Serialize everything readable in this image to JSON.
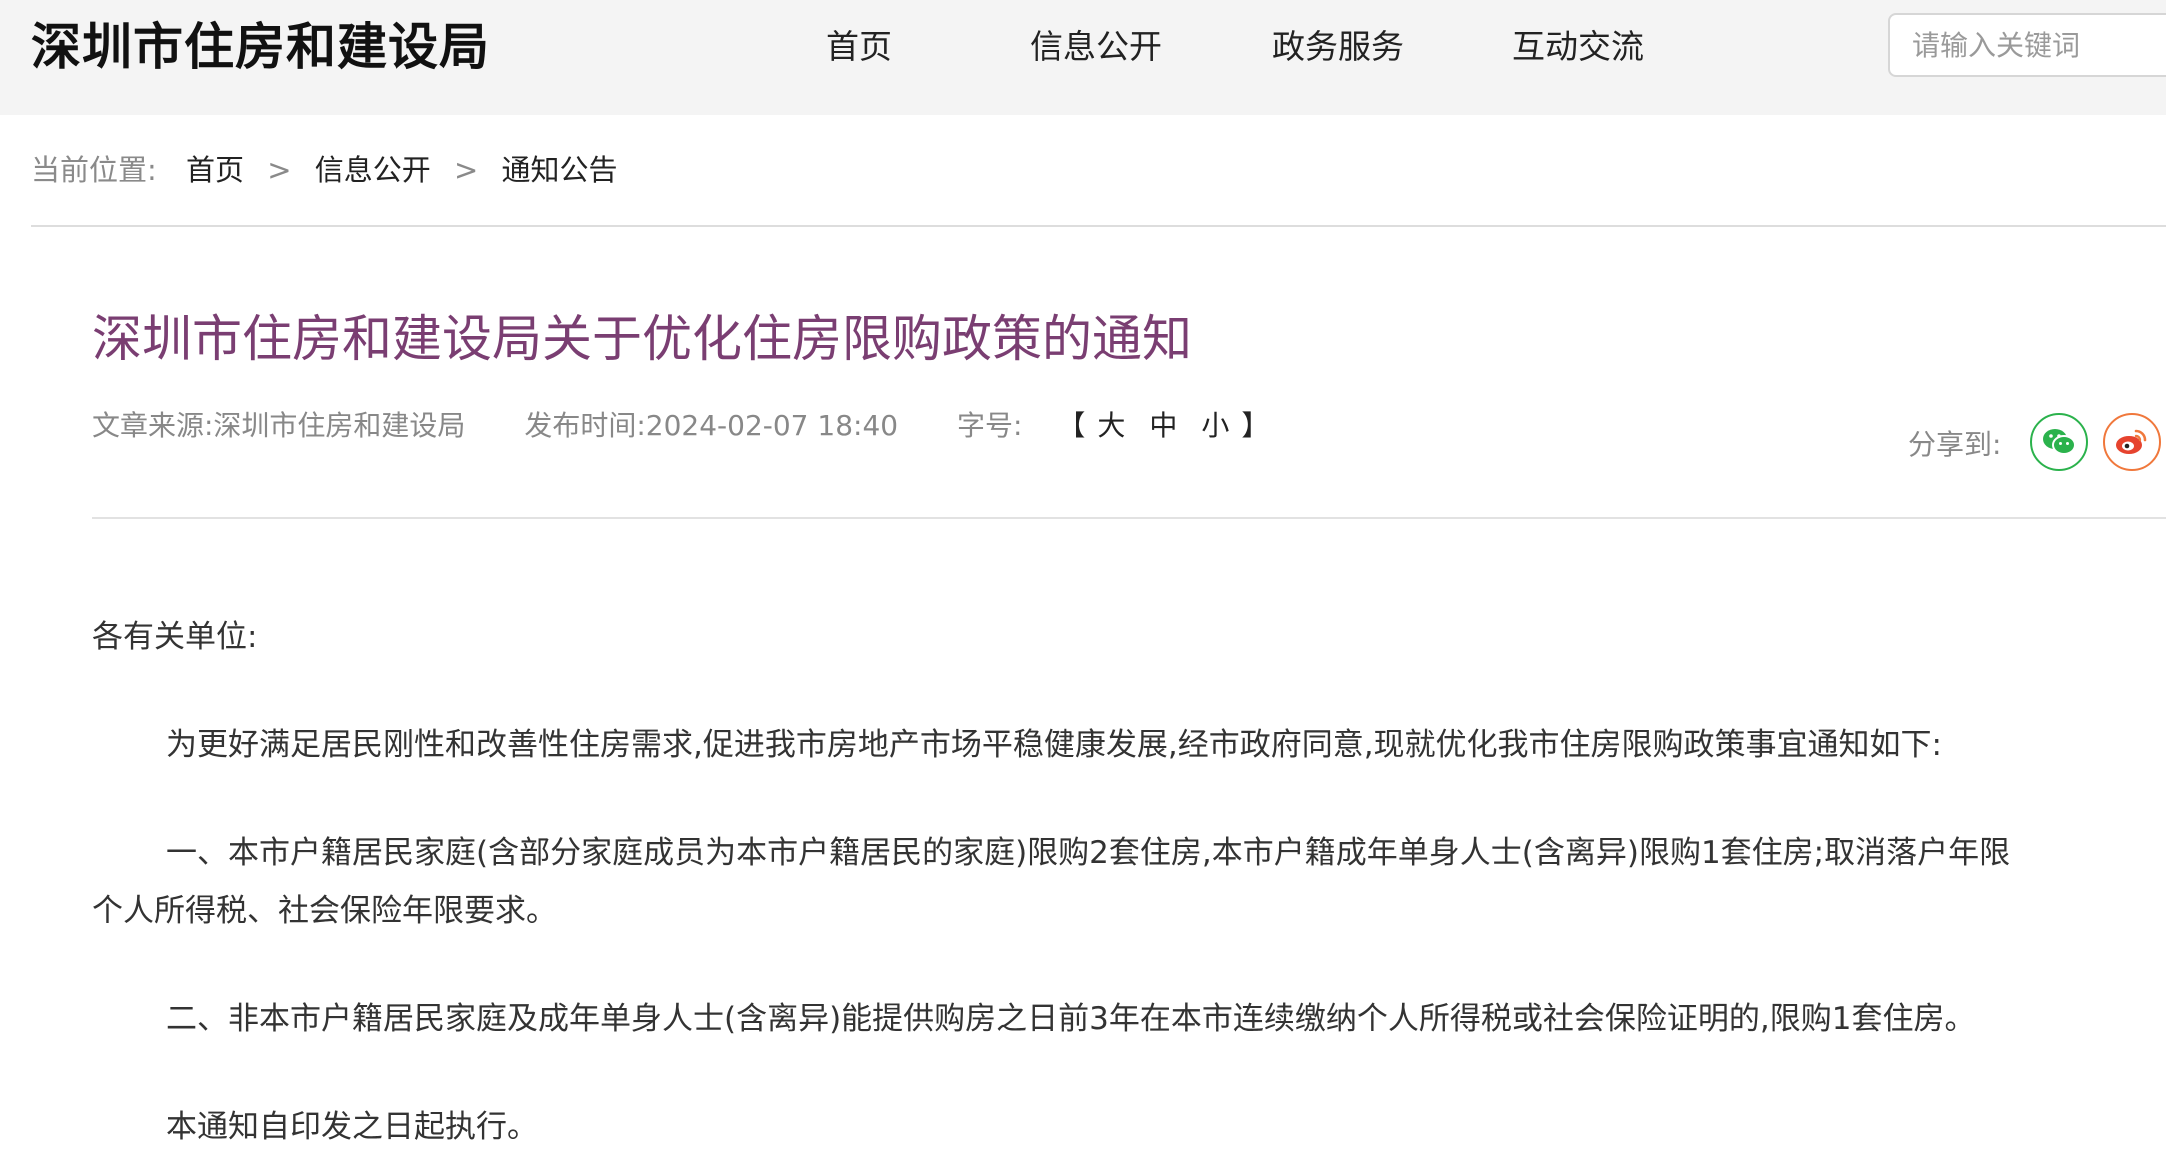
{
  "header": {
    "site_title": "深圳市住房和建设局",
    "nav": [
      "首页",
      "信息公开",
      "政务服务",
      "互动交流"
    ],
    "search_placeholder": "请输入关键词"
  },
  "breadcrumb": {
    "label": "当前位置:",
    "items": [
      "首页",
      "信息公开",
      "通知公告"
    ],
    "separator": ">"
  },
  "article": {
    "title": "深圳市住房和建设局关于优化住房限购政策的通知",
    "source": "文章来源:深圳市住房和建设局",
    "publish_time": "发布时间:2024-02-07 18:40",
    "font_size_label": "字号:",
    "font_size_open": "【",
    "font_size_options": [
      "大",
      "中",
      "小"
    ],
    "font_size_close": "】",
    "share_label": "分享到:",
    "share_icons": [
      "wechat-icon",
      "weibo-icon"
    ],
    "greeting": "各有关单位:",
    "paragraphs": [
      "为更好满足居民刚性和改善性住房需求,促进我市房地产市场平稳健康发展,经市政府同意,现就优化我市住房限购政策事宜通知如下:",
      "一、本市户籍居民家庭(含部分家庭成员为本市户籍居民的家庭)限购2套住房,本市户籍成年单身人士(含离异)限购1套住房;取消落户年限",
      "个人所得税、社会保险年限要求。",
      "二、非本市户籍居民家庭及成年单身人士(含离异)能提供购房之日前3年在本市连续缴纳个人所得税或社会保险证明的,限购1套住房。",
      "本通知自印发之日起执行。"
    ]
  },
  "colors": {
    "title": "#7a3e72",
    "header_bg": "#f4f4f4",
    "wechat": "#2bb24c",
    "weibo": "#f0783c"
  }
}
